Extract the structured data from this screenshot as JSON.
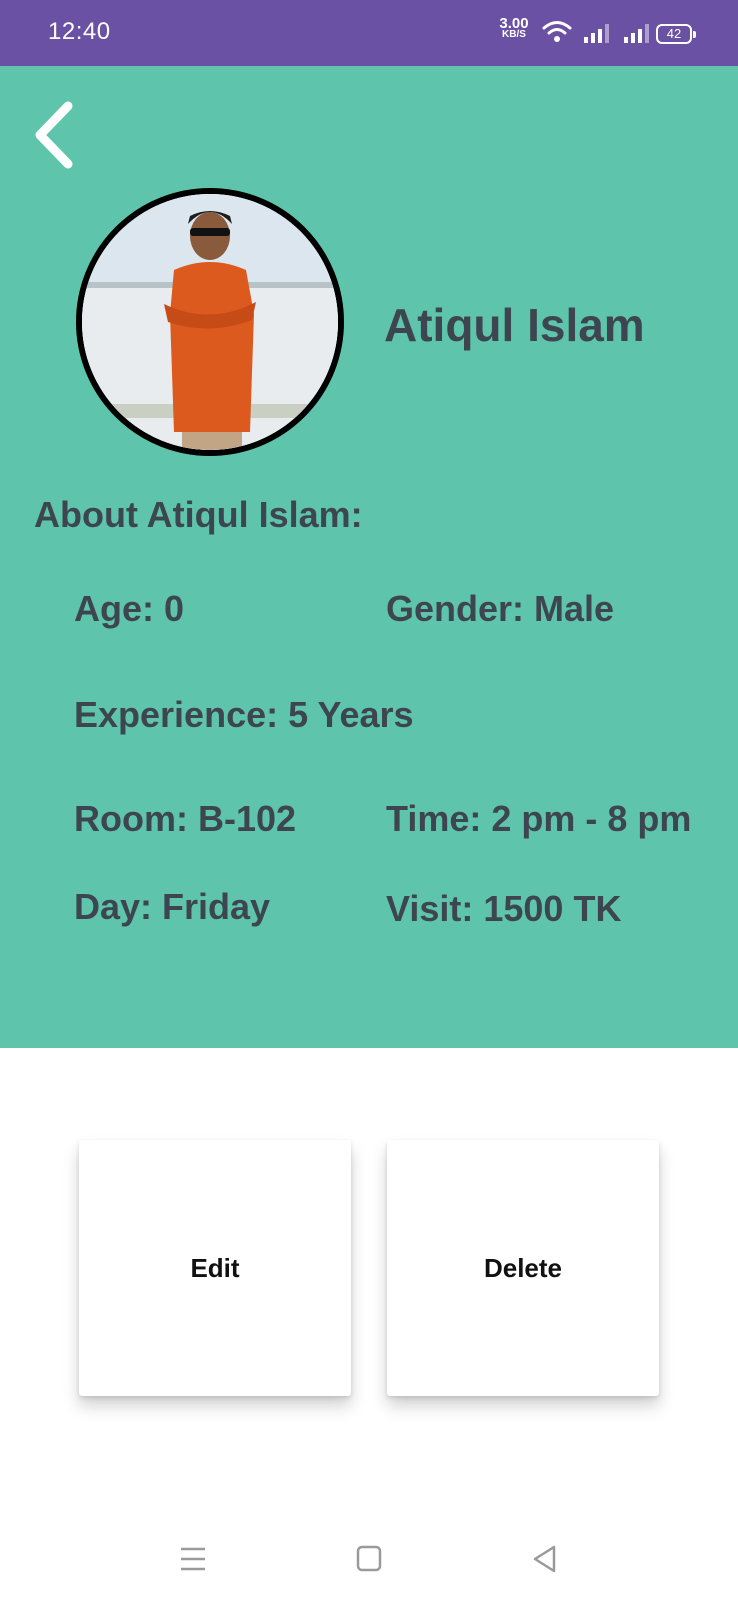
{
  "status_bar": {
    "time": "12:40",
    "net_speed_value": "3.00",
    "net_speed_unit": "KB/S",
    "battery": "42",
    "color": "#6a51a3"
  },
  "header": {
    "background_color": "#5ec5ac",
    "back_icon": "chevron-left-icon"
  },
  "profile": {
    "name": "Atiqul Islam",
    "about_title": "About Atiqul Islam:",
    "age": "Age: 0",
    "gender": "Gender: Male",
    "experience": "Experience: 5 Years",
    "room": "Room: B-102",
    "time": "Time: 2 pm - 8 pm",
    "day": "Day: Friday",
    "visit": "Visit: 1500 TK"
  },
  "actions": {
    "edit_label": "Edit",
    "delete_label": "Delete"
  },
  "nav_bar": {
    "icons": [
      "menu-icon",
      "home-square-icon",
      "back-triangle-icon"
    ]
  }
}
